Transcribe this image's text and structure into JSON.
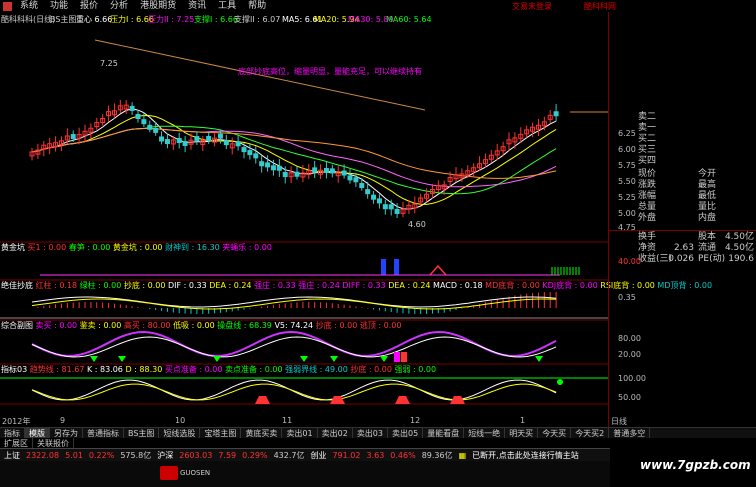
{
  "menu": {
    "items": [
      "系统",
      "功能",
      "报价",
      "分析",
      "港股期货",
      "资讯",
      "工具",
      "帮助"
    ]
  },
  "top_links": {
    "trade": "交易未登录",
    "software": "酷科科网"
  },
  "chart_header": {
    "stock": "酷科科科(日线)",
    "b_main": "BS主图",
    "center_label": "重心",
    "center_value": "6.66",
    "pressure_label": "压力I",
    "pressure_value": "6.66",
    "pressure2_label": "压力II",
    "pressure2_value": "7.25",
    "support_label": "支撑I",
    "support_value": "6.66",
    "support2_label": "支撑II",
    "support2_value": "6.07",
    "ma5": "MA5: 6.61",
    "ma20": "MA20: 5.94",
    "ma30": "MA30: 5.89",
    "ma60": "MA60: 5.64"
  },
  "annotation": "底部抄底高位，缩量明显，量能充足，可以继续持有",
  "price_labels": {
    "high": "7.25",
    "low": "4.60"
  },
  "price_axis": [
    "6.25",
    "6.00",
    "5.75",
    "5.50",
    "5.25",
    "5.00",
    "4.75"
  ],
  "indicators": {
    "gold": {
      "title": "黄金坑",
      "items": [
        "买1 : 0.00",
        "春笋 : 0.00",
        "黄金坑 : 0.00",
        "财神到 : 16.30",
        "夹蝇乐 : 0.00"
      ],
      "axis": "40.00"
    },
    "macd": {
      "title": "绝佳抄底",
      "items": [
        "红柱 : 0.18",
        "绿柱 : 0.00",
        "抄底 : 0.00",
        "DIF : 0.33",
        "DEA : 0.24",
        "强庄 : 0.33",
        "强庄 : 0.24",
        "DIFF : 0.33",
        "DEA : 0.24",
        "MACD : 0.18",
        "MD底背 : 0.00",
        "KDJ底背 : 0.00",
        "RSI底背 : 0.00",
        "MD顶背 : 0.00"
      ],
      "axis": "0.35"
    },
    "combo": {
      "title": "综合副图",
      "items": [
        "卖买 : 0.00",
        "鉴卖 : 0.00",
        "高买 : 80.00",
        "低吸 : 0.00",
        "操盘线 : 68.39",
        "V5: 74.24",
        "抄底 : 0.00",
        "逃顶 : 0.00"
      ],
      "axis": [
        "80.00",
        "20.00"
      ]
    },
    "kdj": {
      "title": "指标03",
      "items": [
        "趋势线 : 81.67",
        "K : 83.06",
        "D : 88.30",
        "买点准备 : 0.00",
        "卖点准备 : 0.00",
        "强弱界线 : 49.00",
        "抄底 : 0.00",
        "强弱 : 0.00"
      ],
      "axis": [
        "100.00",
        "50.00"
      ]
    }
  },
  "dates": [
    "2012年",
    "9",
    "10",
    "11",
    "12",
    "1"
  ],
  "right_panel": {
    "asks": [
      "卖二",
      "卖一",
      "买二",
      "买三",
      "买四",
      "买五"
    ],
    "rows": [
      {
        "l1": "现价",
        "v1": "",
        "l2": "今开",
        "v2": ""
      },
      {
        "l1": "涨跌",
        "v1": "",
        "l2": "最高",
        "v2": ""
      },
      {
        "l1": "涨幅",
        "v1": "",
        "l2": "最低",
        "v2": ""
      },
      {
        "l1": "总量",
        "v1": "",
        "l2": "量比",
        "v2": ""
      },
      {
        "l1": "外盘",
        "v1": "",
        "l2": "内盘",
        "v2": ""
      }
    ],
    "rows2": [
      {
        "l1": "换手",
        "v1": "",
        "l2": "股本",
        "v2": "4.50亿"
      },
      {
        "l1": "净资",
        "v1": "2.63",
        "l2": "流通",
        "v2": "4.50亿"
      },
      {
        "l1": "收益(三)",
        "v1": "0.026",
        "l2": "PE(动)",
        "v2": "190.6"
      }
    ]
  },
  "tabs": [
    "指标",
    "模版",
    "另存为",
    "普通指标",
    "BS主图",
    "短线选股",
    "宝塔主图",
    "黄底买卖",
    "卖出01",
    "卖出02",
    "卖出03",
    "卖出05",
    "量能看盘",
    "短线一绝",
    "明天买",
    "今天买",
    "今天买2",
    "普通多空"
  ],
  "tabs2": [
    "扩展区",
    "关联报价"
  ],
  "right_tab": "日线",
  "status": {
    "sh_label": "上证",
    "sh_value": "2322.08",
    "sh_change": "5.01",
    "sh_pct": "0.22%",
    "sh_amount": "575.8亿",
    "sz_label": "沪深",
    "sz_value": "2603.03",
    "sz_change": "7.59",
    "sz_pct": "0.29%",
    "sz_amount": "432.7亿",
    "cy_label": "创业",
    "cy_value": "791.02",
    "cy_change": "3.63",
    "cy_pct": "0.46%",
    "cy_amount": "89.36亿",
    "msg": "已断开,点击此处连接行情主站"
  },
  "bottom": {
    "logo": "GUOSEN",
    "watermark": "www.7gpzb.com"
  },
  "colors": {
    "up": "#ff3333",
    "down": "#33cccc",
    "ma5": "#ffffff",
    "ma20": "#ffff00",
    "ma30": "#ff66ff",
    "ma60": "#33ff33",
    "grid": "#7a0000"
  }
}
